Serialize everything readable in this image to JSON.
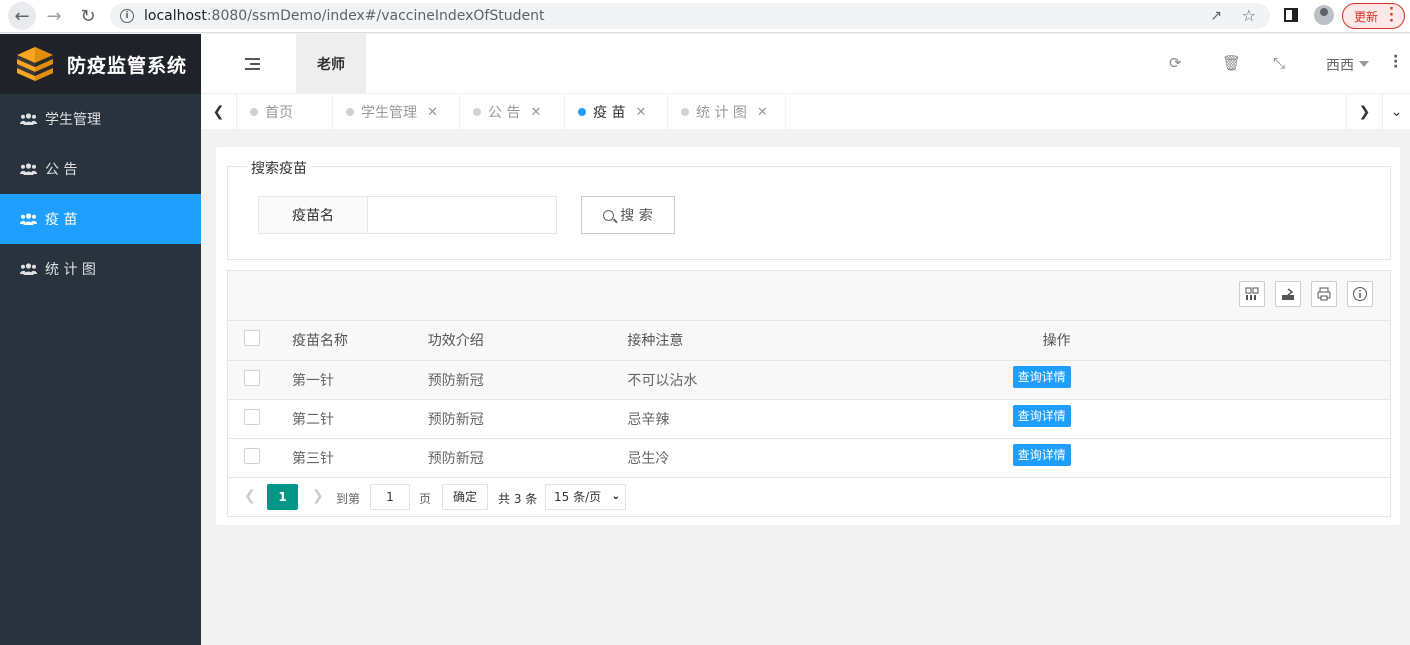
{
  "browser": {
    "url_host": "localhost",
    "url_port": ":8080",
    "url_path": "/ssmDemo/index#/vaccineIndexOfStudent",
    "update_label": "更新"
  },
  "app": {
    "title": "防疫监管系统",
    "role_tab": "老师",
    "user_name": "西西"
  },
  "sidebar": {
    "items": [
      {
        "label": "学生管理",
        "icon": "users-icon",
        "active": false
      },
      {
        "label": "公 告",
        "icon": "users-icon",
        "active": false
      },
      {
        "label": "疫 苗",
        "icon": "users-icon",
        "active": true
      },
      {
        "label": "统 计 图",
        "icon": "users-icon",
        "active": false
      }
    ]
  },
  "tabs": [
    {
      "label": "首页",
      "closable": false
    },
    {
      "label": "学生管理",
      "closable": true
    },
    {
      "label": "公 告",
      "closable": true
    },
    {
      "label": "疫 苗",
      "closable": true,
      "active": true
    },
    {
      "label": "统 计 图",
      "closable": true
    }
  ],
  "search": {
    "legend": "搜索疫苗",
    "field_label": "疫苗名",
    "field_value": "",
    "button_label": "搜 索"
  },
  "table": {
    "headers": [
      "疫苗名称",
      "功效介绍",
      "接种注意",
      "操作"
    ],
    "rows": [
      {
        "name": "第一针",
        "effect": "预防新冠",
        "notice": "不可以沾水",
        "action": "查询详情"
      },
      {
        "name": "第二针",
        "effect": "预防新冠",
        "notice": "忌辛辣",
        "action": "查询详情"
      },
      {
        "name": "第三针",
        "effect": "预防新冠",
        "notice": "忌生冷",
        "action": "查询详情"
      }
    ]
  },
  "pager": {
    "current_page": "1",
    "goto_label": "到第",
    "goto_value": "1",
    "page_unit": "页",
    "confirm_label": "确定",
    "total_text": "共 3 条",
    "page_size": "15 条/页"
  },
  "colors": {
    "sidebar_bg": "#28333e",
    "logo_bg": "#20222a",
    "accent_blue": "#1e9fff",
    "pager_green": "#009688"
  }
}
